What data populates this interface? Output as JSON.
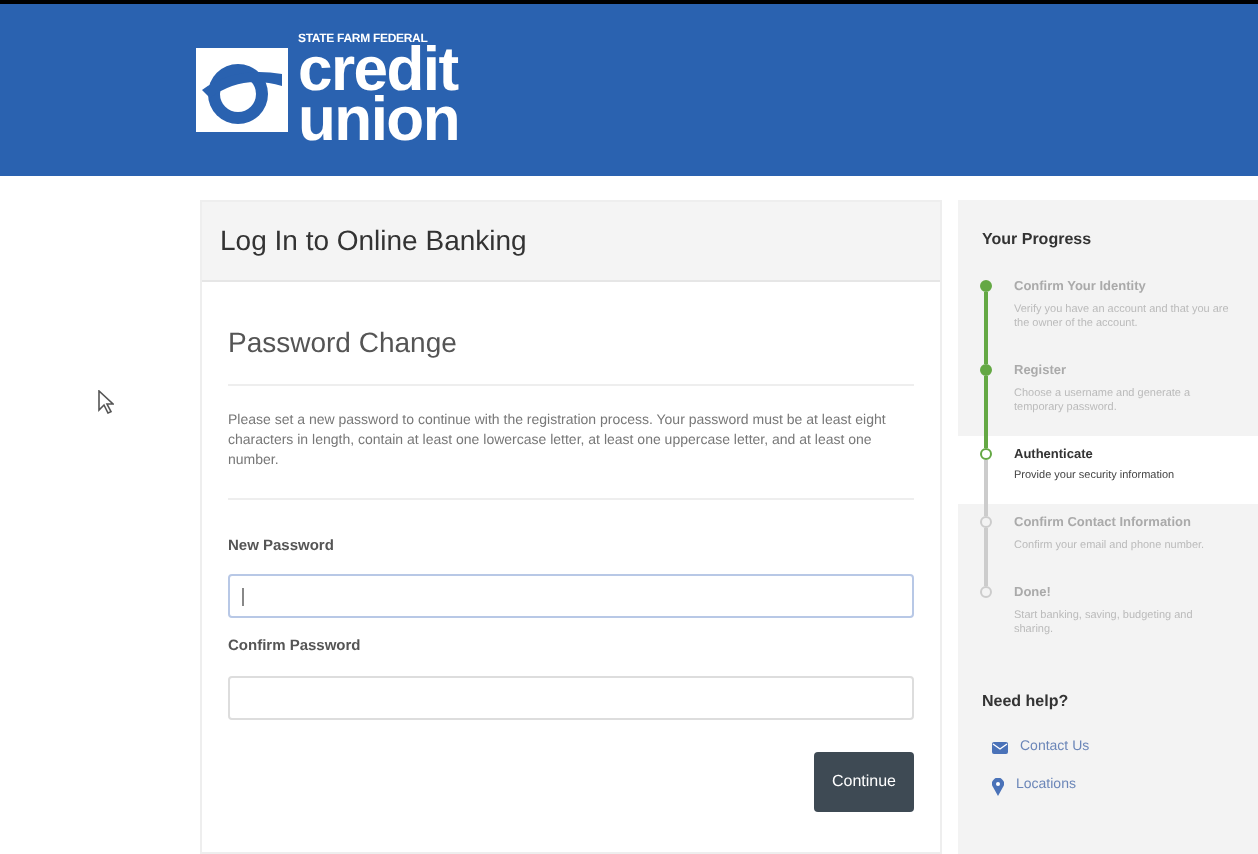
{
  "header": {
    "logo": {
      "tagline": "STATE FARM FEDERAL",
      "line_1": "credit",
      "line_2": "union"
    }
  },
  "main": {
    "title": "Log In to Online Banking",
    "heading": "Password Change",
    "instructions": "Please set a new password to continue with the registration process. Your password must be at least eight characters in length, contain at least one lowercase letter, at least one uppercase letter, and at least one number.",
    "fields": [
      {
        "label": "New Password",
        "focused": true
      },
      {
        "label": "Confirm Password",
        "focused": false
      }
    ],
    "button": "Continue"
  },
  "sidebar": {
    "title": "Your Progress",
    "steps": [
      {
        "title": "Confirm Your Identity",
        "description": "Verify you have an account and that you are the owner of the account.",
        "completed": true,
        "current": false
      },
      {
        "title": "Register",
        "description": "Choose a username and generate a temporary password.",
        "completed": true,
        "current": false
      },
      {
        "title": "Authenticate",
        "description": "Provide your security information",
        "completed": false,
        "current": true
      },
      {
        "title": "Confirm Contact Information",
        "description": "Confirm your email and phone number.",
        "completed": false,
        "current": false
      },
      {
        "title": "Done!",
        "description": "Start banking, saving, budgeting and sharing.",
        "completed": false,
        "current": false
      }
    ],
    "help_title": "Need help?",
    "help_links": [
      {
        "label": "Contact Us",
        "kind": "mail"
      },
      {
        "label": "Locations",
        "kind": "pin"
      }
    ]
  }
}
